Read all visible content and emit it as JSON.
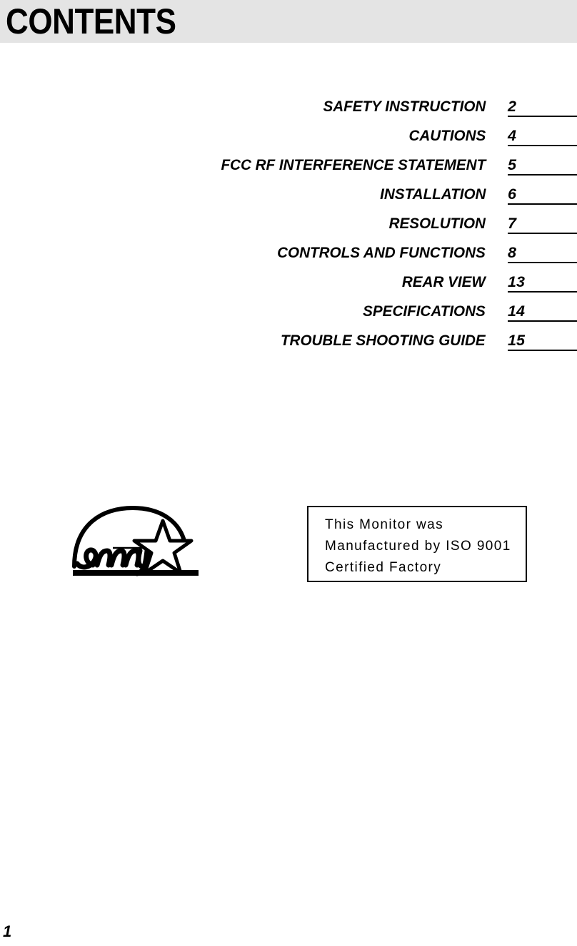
{
  "header": {
    "title": "CONTENTS",
    "background_color": "#e4e4e4"
  },
  "contents": {
    "entries": [
      {
        "label": "SAFETY INSTRUCTION",
        "page": "2"
      },
      {
        "label": "CAUTIONS",
        "page": "4"
      },
      {
        "label": "FCC RF INTERFERENCE STATEMENT",
        "page": "5"
      },
      {
        "label": "INSTALLATION",
        "page": "6"
      },
      {
        "label": "RESOLUTION",
        "page": "7"
      },
      {
        "label": "CONTROLS AND FUNCTIONS",
        "page": "8"
      },
      {
        "label": "REAR VIEW",
        "page": "13"
      },
      {
        "label": "SPECIFICATIONS",
        "page": "14"
      },
      {
        "label": "TROUBLE SHOOTING GUIDE",
        "page": "15"
      }
    ]
  },
  "logo": {
    "name": "energy-star-logo"
  },
  "iso_notice": {
    "text": "This Monitor was\nManufactured by ISO 9001\nCertified Factory"
  },
  "footer": {
    "folio": "1"
  }
}
